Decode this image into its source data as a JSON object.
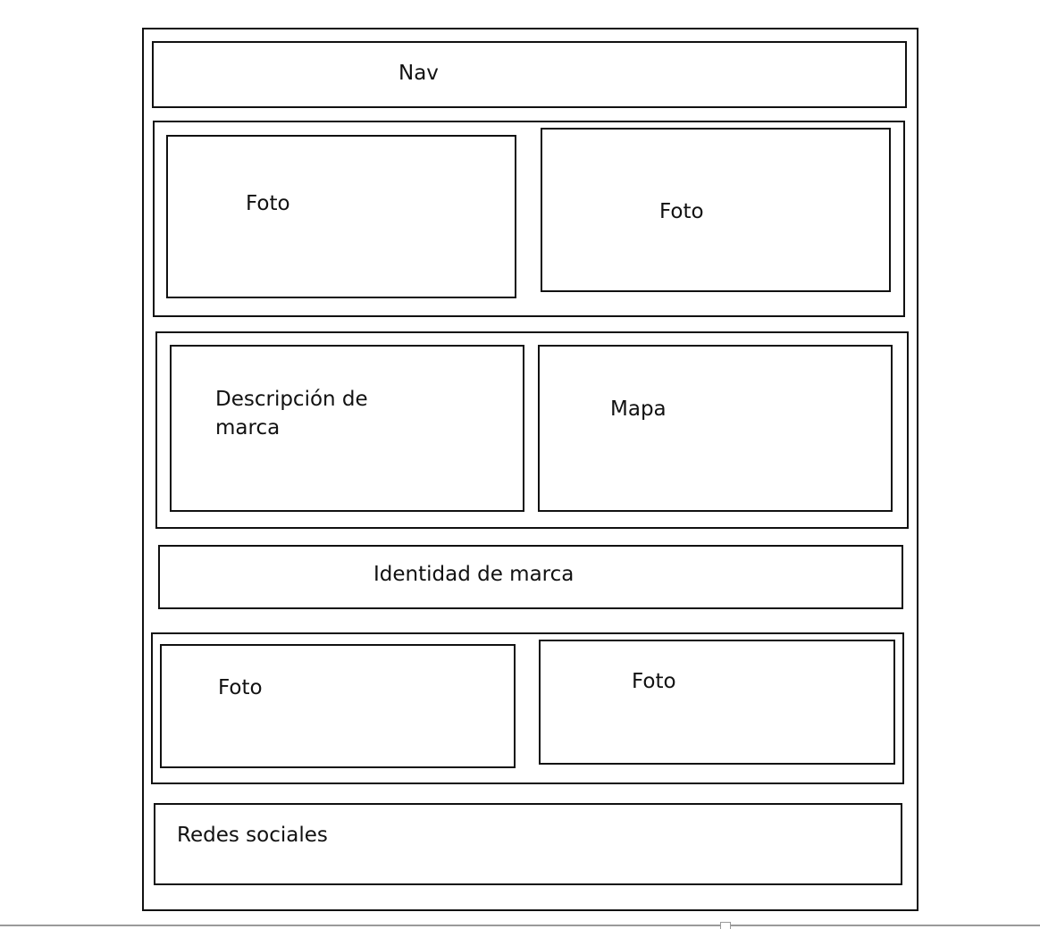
{
  "wireframe": {
    "nav": {
      "label": "Nav"
    },
    "hero": {
      "left_photo": "Foto",
      "right_photo": "Foto"
    },
    "about": {
      "description": "Descripción de\nmarca",
      "map": "Mapa"
    },
    "identity": {
      "label": "Identidad de marca"
    },
    "gallery": {
      "left_photo": "Foto",
      "right_photo": "Foto"
    },
    "footer": {
      "label": "Redes sociales"
    }
  }
}
